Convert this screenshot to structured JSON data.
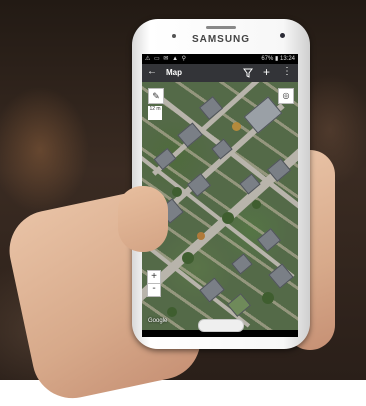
{
  "device": {
    "brand": "SAMSUNG"
  },
  "status_bar": {
    "left_icons": "⚠ ▭ ✉ ▲ ⚲",
    "battery": "67%",
    "time": "13:24"
  },
  "app_bar": {
    "title": "Map",
    "back_icon": "back-arrow-icon",
    "filter_icon": "filter-icon",
    "add_icon": "add-icon",
    "more_icon": "more-vertical-icon"
  },
  "map": {
    "scale_label": "12 m",
    "zoom_in_label": "+",
    "zoom_out_label": "-",
    "attribution": "Google"
  },
  "colors": {
    "app_bar": "#333438",
    "status_bar": "#000000"
  }
}
